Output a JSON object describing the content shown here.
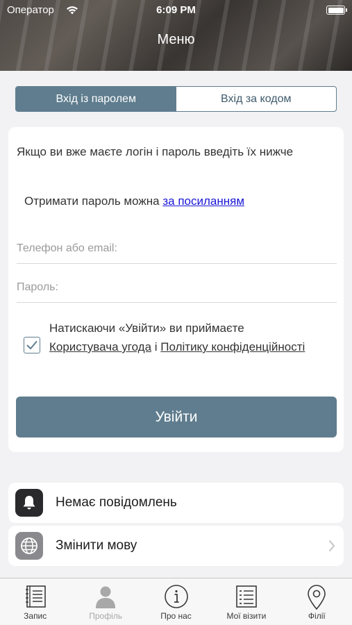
{
  "status_bar": {
    "carrier": "Оператор",
    "time": "6:09 PM"
  },
  "header": {
    "title": "Меню"
  },
  "segmented": {
    "password_label": "Вхід із паролем",
    "code_label": "Вхід за кодом",
    "selected": "password"
  },
  "login_card": {
    "intro": "Якщо ви вже маєте логін і пароль введіть їх нижче",
    "password_hint": "Отримати пароль можна",
    "password_link": "за посиланням",
    "phone_placeholder": "Телефон або email:",
    "password_placeholder": "Пароль:",
    "agree_prefix": "Натискаючи «Увійти» ви приймаєте",
    "agreement_link": "Користувача угода",
    "and": "і",
    "privacy_link": "Політику конфіденційності",
    "checkbox_checked": true,
    "login_button": "Увійти"
  },
  "rows": {
    "notifications": {
      "label": "Немає повідомлень",
      "icon": "bell-icon"
    },
    "language": {
      "label": "Змінити мову",
      "icon": "globe-icon"
    }
  },
  "tabbar": {
    "tabs": [
      {
        "label": "Запис",
        "icon": "notebook-icon"
      },
      {
        "label": "Профіль",
        "icon": "person-icon"
      },
      {
        "label": "Про нас",
        "icon": "info-icon"
      },
      {
        "label": "Мої візити",
        "icon": "list-icon"
      },
      {
        "label": "Філії",
        "icon": "location-pin-icon"
      }
    ],
    "active_index": 1
  },
  "colors": {
    "accent": "#5f7d8e",
    "link": "#1a17d6",
    "background": "#f2f2f4"
  }
}
